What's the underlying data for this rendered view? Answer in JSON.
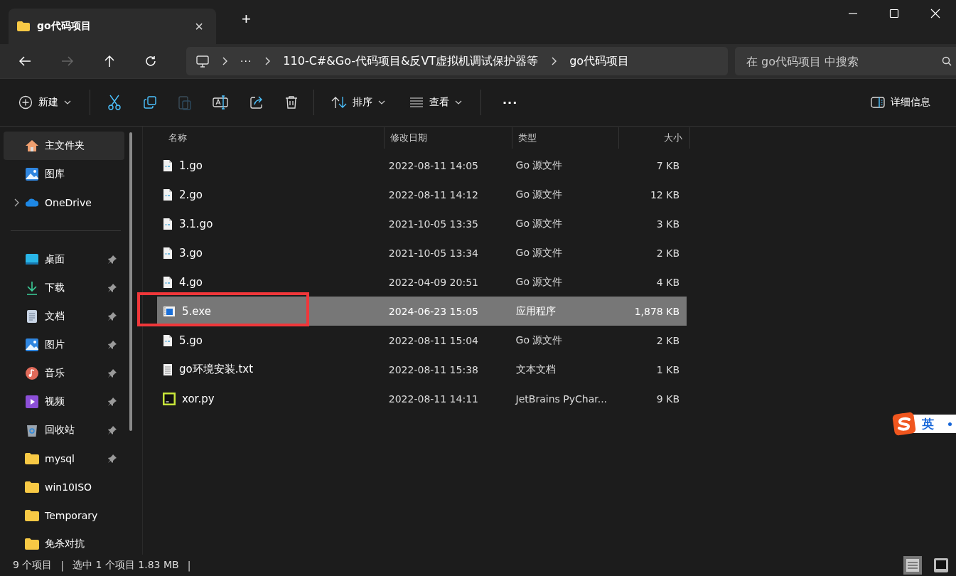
{
  "tab": {
    "title": "go代码项目",
    "close": "×"
  },
  "new_tab": "+",
  "address": {
    "crumbs": [
      "···",
      "110-C#&Go-代码项目&反VT虚拟机调试保护器等",
      "go代码项目"
    ]
  },
  "search": {
    "placeholder": "在 go代码项目 中搜索"
  },
  "toolbar": {
    "new": "新建",
    "sort": "排序",
    "view": "查看",
    "more": "···",
    "details": "详细信息"
  },
  "sidebar": {
    "groups": [
      {
        "items": [
          {
            "label": "主文件夹",
            "kind": "home",
            "selected": true,
            "pinned": false,
            "expandable": false
          },
          {
            "label": "图库",
            "kind": "gallery",
            "selected": false,
            "pinned": false,
            "expandable": false
          },
          {
            "label": "OneDrive",
            "kind": "cloud",
            "selected": false,
            "pinned": false,
            "expandable": true
          }
        ]
      },
      {
        "items": [
          {
            "label": "桌面",
            "kind": "desktop",
            "selected": false,
            "pinned": true,
            "expandable": false
          },
          {
            "label": "下载",
            "kind": "download",
            "selected": false,
            "pinned": true,
            "expandable": false
          },
          {
            "label": "文档",
            "kind": "document",
            "selected": false,
            "pinned": true,
            "expandable": false
          },
          {
            "label": "图片",
            "kind": "gallery",
            "selected": false,
            "pinned": true,
            "expandable": false
          },
          {
            "label": "音乐",
            "kind": "music",
            "selected": false,
            "pinned": true,
            "expandable": false
          },
          {
            "label": "视频",
            "kind": "video",
            "selected": false,
            "pinned": true,
            "expandable": false
          },
          {
            "label": "回收站",
            "kind": "bin",
            "selected": false,
            "pinned": true,
            "expandable": false
          },
          {
            "label": "mysql",
            "kind": "folder",
            "selected": false,
            "pinned": true,
            "expandable": false
          },
          {
            "label": "win10ISO",
            "kind": "folder",
            "selected": false,
            "pinned": false,
            "expandable": false
          },
          {
            "label": "Temporary",
            "kind": "folder",
            "selected": false,
            "pinned": false,
            "expandable": false
          },
          {
            "label": "免杀对抗",
            "kind": "folder",
            "selected": false,
            "pinned": false,
            "expandable": false
          }
        ]
      }
    ]
  },
  "table": {
    "columns": [
      "名称",
      "修改日期",
      "类型",
      "大小"
    ],
    "rows": [
      {
        "name": "1.go",
        "date": "2022-08-11 14:05",
        "type": "Go 源文件",
        "size": "7 KB",
        "kind": "go",
        "selected": false,
        "annotated": false
      },
      {
        "name": "2.go",
        "date": "2022-08-11 14:12",
        "type": "Go 源文件",
        "size": "12 KB",
        "kind": "go",
        "selected": false,
        "annotated": false
      },
      {
        "name": "3.1.go",
        "date": "2021-10-05 13:35",
        "type": "Go 源文件",
        "size": "3 KB",
        "kind": "go",
        "selected": false,
        "annotated": false
      },
      {
        "name": "3.go",
        "date": "2021-10-05 13:34",
        "type": "Go 源文件",
        "size": "2 KB",
        "kind": "go",
        "selected": false,
        "annotated": false
      },
      {
        "name": "4.go",
        "date": "2022-04-09 20:51",
        "type": "Go 源文件",
        "size": "4 KB",
        "kind": "go",
        "selected": false,
        "annotated": false
      },
      {
        "name": "5.exe",
        "date": "2024-06-23 15:05",
        "type": "应用程序",
        "size": "1,878 KB",
        "kind": "exe",
        "selected": true,
        "annotated": true
      },
      {
        "name": "5.go",
        "date": "2022-08-11 15:04",
        "type": "Go 源文件",
        "size": "2 KB",
        "kind": "go",
        "selected": false,
        "annotated": false
      },
      {
        "name": "go环境安装.txt",
        "date": "2022-08-11 15:38",
        "type": "文本文档",
        "size": "1 KB",
        "kind": "txt",
        "selected": false,
        "annotated": false
      },
      {
        "name": "xor.py",
        "date": "2022-08-11 14:11",
        "type": "JetBrains PyChar...",
        "size": "9 KB",
        "kind": "pycharm",
        "selected": false,
        "annotated": false
      }
    ]
  },
  "status_bar": {
    "count": "9 个项目",
    "separator_1": "|",
    "selection": "选中 1 个项目  1.83 MB",
    "separator_2": "|"
  },
  "ime": {
    "label": "英"
  }
}
